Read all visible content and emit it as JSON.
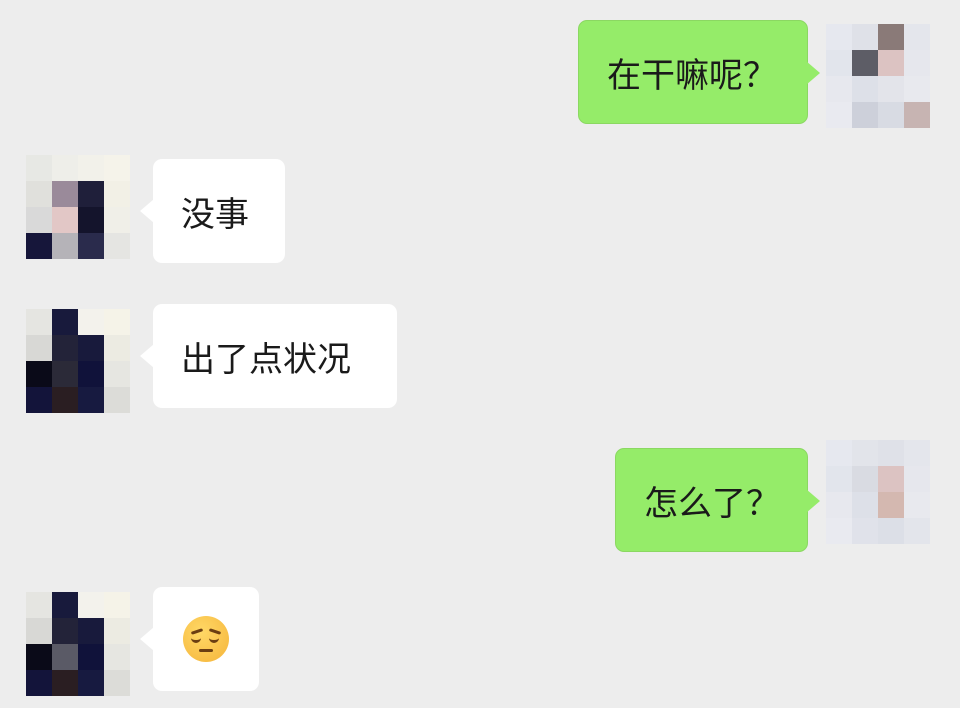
{
  "chat": {
    "messages": [
      {
        "side": "right",
        "text": "在干嘛呢？"
      },
      {
        "side": "left",
        "text": "没事"
      },
      {
        "side": "left",
        "text": "出了点状况"
      },
      {
        "side": "right",
        "text": "怎么了？"
      },
      {
        "side": "left",
        "text": "",
        "emoji": "pensive-face-emoji"
      }
    ]
  },
  "colors": {
    "background": "#ededed",
    "sent_bubble": "#95ec69",
    "received_bubble": "#ffffff"
  }
}
